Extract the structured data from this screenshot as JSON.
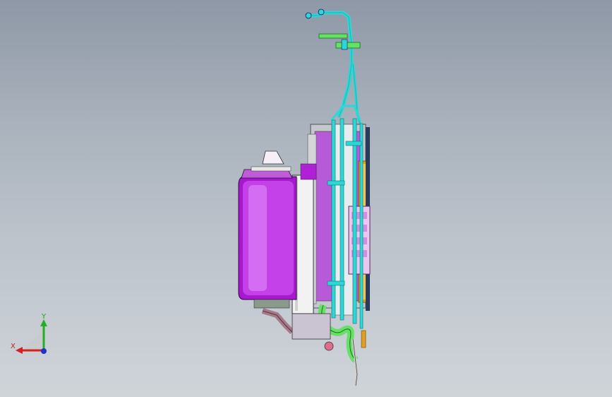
{
  "triad": {
    "x_label": "X",
    "y_label": "Y",
    "x_color": "#d42020",
    "y_color": "#22b022",
    "z_color": "#2030d0"
  },
  "colors": {
    "background_top": "#8e98a6",
    "background_bottom": "#cfd4d9",
    "tank_magenta": "#b020d8",
    "pipe_cyan": "#2ed6d6",
    "fitting_green": "#66e066",
    "side_orange": "#e0a020",
    "plate_white": "#f2f2f2"
  }
}
